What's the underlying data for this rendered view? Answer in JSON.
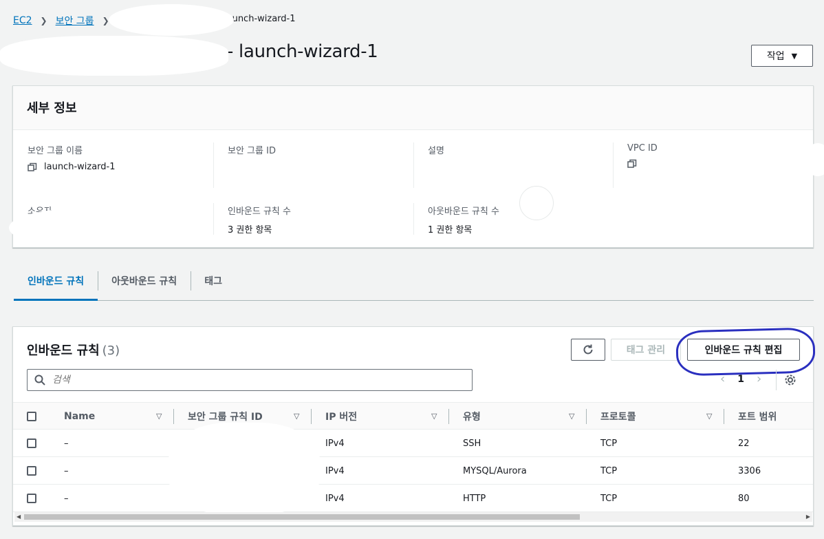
{
  "breadcrumb": {
    "root": "EC2",
    "security_groups": "보안 그룹",
    "current_tail": "launch-wizard-1"
  },
  "page_title": "- launch-wizard-1",
  "actions_button": "작업",
  "details": {
    "header": "세부 정보",
    "sg_name_label": "보안 그룹 이름",
    "sg_name_value": "launch-wizard-1",
    "sg_id_label": "보안 그룹 ID",
    "description_label": "설명",
    "vpc_id_label": "VPC ID",
    "owner_label": "소유자",
    "inbound_count_label": "인바운드 규칙 수",
    "inbound_count_value": "3 권한 항목",
    "outbound_count_label": "아웃바운드 규칙 수",
    "outbound_count_value": "1 권한 항목"
  },
  "tabs": [
    {
      "label": "인바운드 규칙",
      "active": true
    },
    {
      "label": "아웃바운드 규칙",
      "active": false
    },
    {
      "label": "태그",
      "active": false
    }
  ],
  "inbound": {
    "title": "인바운드 규칙",
    "count": "(3)",
    "manage_tags": "태그 관리",
    "edit_rules": "인바운드 규칙 편집",
    "search_placeholder": "검색",
    "page": "1",
    "columns": [
      "Name",
      "보안 그룹 규칙 ID",
      "IP 버전",
      "유형",
      "프로토콜",
      "포트 범위"
    ],
    "rows": [
      {
        "name": "–",
        "rule_id": "",
        "ip_version": "IPv4",
        "type": "SSH",
        "protocol": "TCP",
        "port": "22"
      },
      {
        "name": "–",
        "rule_id": "",
        "ip_version": "IPv4",
        "type": "MYSQL/Aurora",
        "protocol": "TCP",
        "port": "3306"
      },
      {
        "name": "–",
        "rule_id": "",
        "ip_version": "IPv4",
        "type": "HTTP",
        "protocol": "TCP",
        "port": "80"
      }
    ]
  },
  "icons": {
    "copy": "copy-icon",
    "refresh": "refresh-icon",
    "search": "search-icon",
    "settings": "gear-icon"
  },
  "colors": {
    "link": "#0073bb",
    "highlight": "#2a2fbf"
  }
}
